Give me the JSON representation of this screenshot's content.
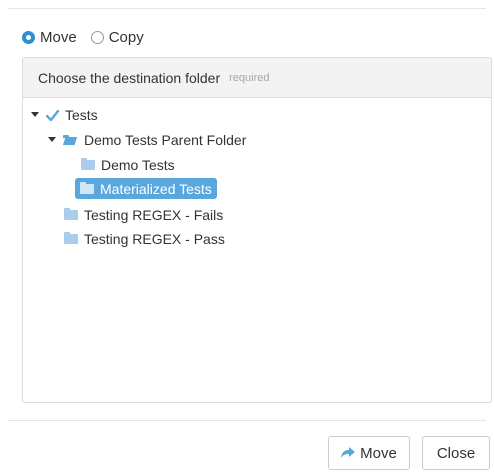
{
  "mode": {
    "options": [
      {
        "label": "Move",
        "checked": true
      },
      {
        "label": "Copy",
        "checked": false
      }
    ]
  },
  "panel": {
    "title": "Choose the destination folder",
    "required": "required"
  },
  "tree": {
    "root": {
      "label": "Tests",
      "icon": "check-icon",
      "expanded": true
    },
    "parent": {
      "label": "Demo Tests Parent Folder",
      "icon": "folder-open-icon",
      "expanded": true
    },
    "child1": {
      "label": "Demo Tests",
      "icon": "folder-icon"
    },
    "child2": {
      "label": "Materialized Tests",
      "icon": "folder-icon",
      "selected": true
    },
    "sibling1": {
      "label": "Testing REGEX - Fails",
      "icon": "folder-icon"
    },
    "sibling2": {
      "label": "Testing REGEX - Pass",
      "icon": "folder-icon"
    }
  },
  "footer": {
    "move_label": "Move",
    "move_icon": "share-arrow-icon",
    "close_label": "Close"
  },
  "colors": {
    "accent": "#2d8fd5",
    "selected_bg": "#5aa7dd",
    "folder": "#a9cdeb"
  }
}
